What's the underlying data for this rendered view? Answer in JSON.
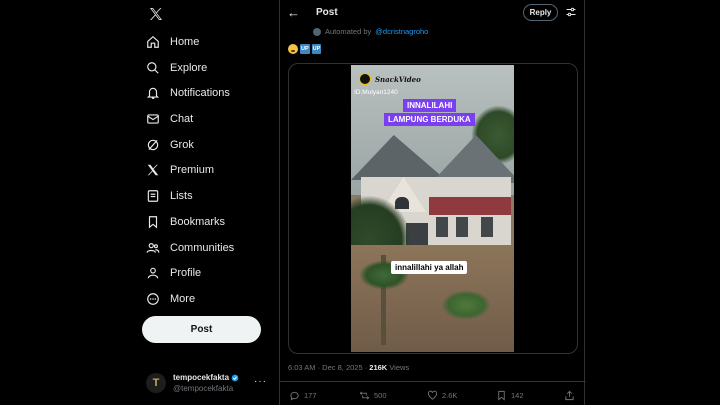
{
  "sidebar": {
    "items": [
      {
        "label": "Home",
        "icon": "home-icon"
      },
      {
        "label": "Explore",
        "icon": "search-icon"
      },
      {
        "label": "Notifications",
        "icon": "bell-icon"
      },
      {
        "label": "Chat",
        "icon": "mail-icon"
      },
      {
        "label": "Grok",
        "icon": "grok-icon"
      },
      {
        "label": "Premium",
        "icon": "x-icon"
      },
      {
        "label": "Lists",
        "icon": "list-icon"
      },
      {
        "label": "Bookmarks",
        "icon": "bookmark-icon"
      },
      {
        "label": "Communities",
        "icon": "people-icon"
      },
      {
        "label": "Profile",
        "icon": "person-icon"
      },
      {
        "label": "More",
        "icon": "more-circle-icon"
      }
    ],
    "post_label": "Post",
    "account": {
      "avatar_letter": "T",
      "name": "tempocekfakta",
      "handle": "@tempocekfakta"
    }
  },
  "header": {
    "title": "Post",
    "reply_label": "Reply"
  },
  "post": {
    "automated_prefix": "Automated by",
    "automated_link": "@dcristnagroho",
    "emoji_up_1": "UP",
    "emoji_up_2": "UP",
    "video": {
      "watermark": "SnackVideo",
      "id_text": "ID:Mulyan1240",
      "banner_line1": "INNALILAHI",
      "banner_line2": "LAMPUNG BERDUKA",
      "caption": "innalillahi ya allah"
    },
    "time": "6:03 AM · Dec 8, 2025 · ",
    "views_count": "216K",
    "views_label": " Views",
    "stats": {
      "replies": "177",
      "reposts": "500",
      "likes": "2.6K",
      "bookmarks": "142"
    }
  },
  "colors": {
    "accent": "#1d9bf0",
    "banner": "#7b3ff2"
  }
}
